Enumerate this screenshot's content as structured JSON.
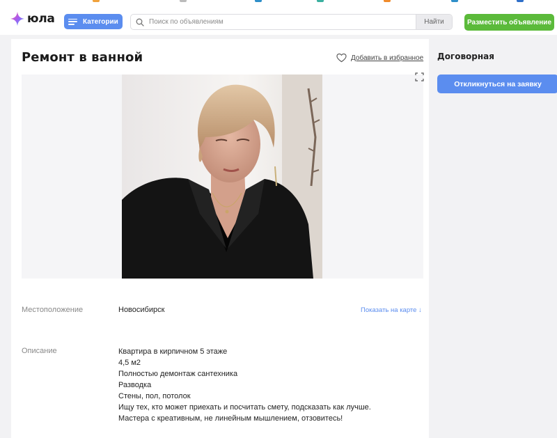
{
  "header": {
    "logo_text": "юла",
    "categories_label": "Категории",
    "search_placeholder": "Поиск по объявлениям",
    "search_button_label": "Найти",
    "post_ad_label": "Разместить объявление"
  },
  "listing": {
    "title": "Ремонт в ванной",
    "favorite_label": "Добавить в избранное",
    "location_label": "Местоположение",
    "location_value": "Новосибирск",
    "show_on_map_label": "Показать на карте ↓",
    "description_label": "Описание",
    "description_lines": [
      "Квартира в кирпичном 5 этаже",
      "4,5 м2",
      "Полностью демонтаж сантехника",
      "Разводка",
      "Стены, пол, потолок",
      "Ищу тех, кто может приехать и посчитать смету, подсказать как лучше.",
      "Мастера с креативным, не линейным мышлением, отзовитесь!"
    ]
  },
  "sidebar": {
    "price": "Договорная",
    "respond_label": "Откликнуться на заявку"
  },
  "icons": {
    "logo": "star-icon",
    "categories": "menu-icon",
    "search": "search-icon",
    "favorite": "heart-icon",
    "expand": "fullscreen-icon"
  },
  "colors": {
    "accent_blue": "#5b8def",
    "accent_green": "#5bba3a",
    "background": "#f2f2f4"
  }
}
